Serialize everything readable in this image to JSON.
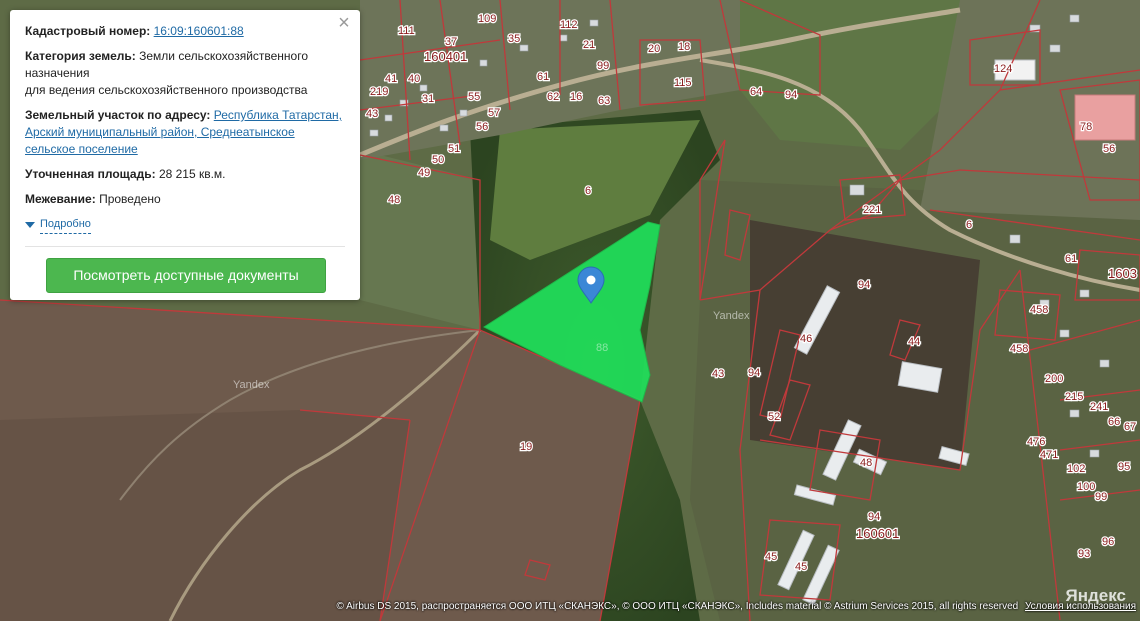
{
  "map": {
    "selected_parcel_label": "88",
    "parcel_labels": [
      "6",
      "19",
      "94",
      "94",
      "94",
      "43",
      "44",
      "52",
      "46",
      "48",
      "45",
      "45",
      "221",
      "6",
      "124",
      "78",
      "56",
      "111",
      "37",
      "109",
      "35",
      "112",
      "21",
      "99",
      "20",
      "18",
      "115",
      "64",
      "94",
      "63",
      "62",
      "16",
      "61",
      "41",
      "40",
      "219",
      "43",
      "31",
      "56",
      "55",
      "57",
      "51",
      "50",
      "49",
      "48",
      "458",
      "458",
      "61",
      "200",
      "215",
      "241",
      "476",
      "471",
      "102",
      "100",
      "99",
      "93",
      "96",
      "66",
      "67",
      "95",
      "1603"
    ],
    "quarter_labels": [
      "160401",
      "160601"
    ],
    "watermark": "Yandex"
  },
  "panel": {
    "close_icon": "close-icon",
    "cadastral": {
      "label": "Кадастровый номер:",
      "value": "16:09:160601:88"
    },
    "category": {
      "label": "Категория земель:",
      "value": "Земли сельскохозяйственного назначения",
      "value2": "для ведения сельскохозяйственного производства"
    },
    "address": {
      "label": "Земельный участок по адресу:",
      "value": "Республика Татарстан, Арский муниципальный район, Среднеатынское сельское поселение"
    },
    "area": {
      "label": "Уточненная площадь:",
      "value": "28 215 кв.м."
    },
    "survey": {
      "label": "Межевание:",
      "value": "Проведено"
    },
    "more_link": "Подробно",
    "docs_button": "Посмотреть доступные документы"
  },
  "footer": {
    "attribution": "© Airbus DS 2015, распространяется ООО ИТЦ «СКАНЭКС», © ООО ИТЦ «СКАНЭКС», Includes material © Astrium Services 2015, all rights reserved",
    "terms_link": "Условия использования",
    "logo": "Яндекс"
  },
  "colors": {
    "parcel_border": "#c0393b",
    "selected_fill": "#1fe05a",
    "marker": "#3b87d6",
    "button": "#4cb74f"
  }
}
